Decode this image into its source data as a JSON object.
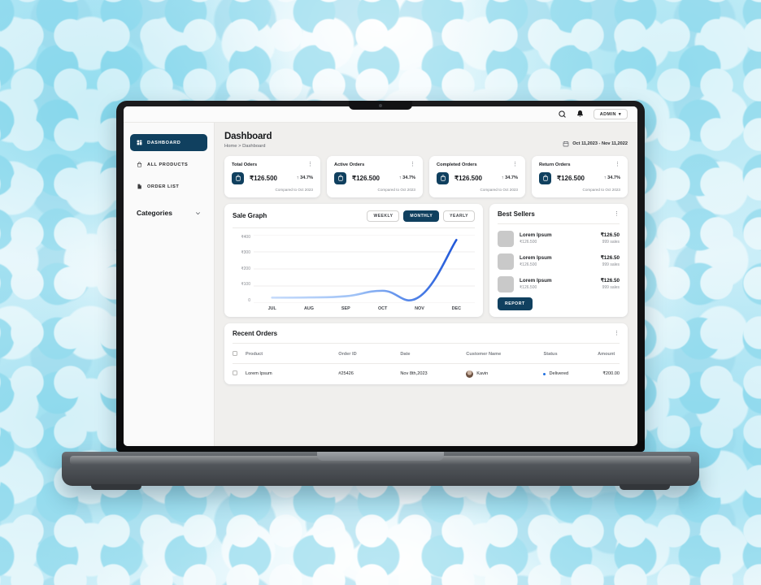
{
  "topbar": {
    "search_icon": "search-icon",
    "bell_icon": "bell-icon",
    "admin_label": "ADMIN",
    "admin_caret": "▾"
  },
  "sidebar": {
    "items": [
      {
        "label": "DASHBOARD",
        "icon": "grid-icon",
        "active": true
      },
      {
        "label": "ALL PRODUCTS",
        "icon": "bag-icon",
        "active": false
      },
      {
        "label": "ORDER LIST",
        "icon": "document-icon",
        "active": false
      }
    ],
    "categories_label": "Categories",
    "categories_icon": "chevron-down-icon"
  },
  "header": {
    "title": "Dashboard",
    "breadcrumb": "Home > Dashboard",
    "date_range": "Oct 11,2023 - Nov 11,2022",
    "calendar_icon": "calendar-icon"
  },
  "stats": [
    {
      "label": "Total Oders",
      "value": "₹126.500",
      "delta": "↑ 34.7%",
      "sub": "Compared to Oct 2023",
      "icon": "bag-icon",
      "menu": "⋮"
    },
    {
      "label": "Active Orders",
      "value": "₹126.500",
      "delta": "↑ 34.7%",
      "sub": "Compared to Oct 2023",
      "icon": "bag-icon",
      "menu": "⋮"
    },
    {
      "label": "Completed Orders",
      "value": "₹126.500",
      "delta": "↑ 34.7%",
      "sub": "Compared to Oct 2023",
      "icon": "bag-icon",
      "menu": "⋮"
    },
    {
      "label": "Return Orders",
      "value": "₹126.500",
      "delta": "↑ 34.7%",
      "sub": "Compared to Oct 2023",
      "icon": "bag-icon",
      "menu": "⋮"
    }
  ],
  "sale_graph": {
    "title": "Sale Graph",
    "segments": [
      {
        "label": "WEEKLY",
        "active": false
      },
      {
        "label": "MONTHLY",
        "active": true
      },
      {
        "label": "YEARLY",
        "active": false
      }
    ]
  },
  "chart_data": {
    "type": "line",
    "title": "Sale Graph",
    "xlabel": "",
    "ylabel": "",
    "categories": [
      "JUL",
      "AUG",
      "SEP",
      "OCT",
      "NOV",
      "DEC"
    ],
    "x_tick_labels": [
      "JUL",
      "AUG",
      "SEP",
      "OCT",
      "NOV",
      "DEC"
    ],
    "y_tick_labels": [
      "₹400",
      "₹300",
      "₹200",
      "₹100",
      "0"
    ],
    "y_ticks": [
      400,
      300,
      200,
      100,
      0
    ],
    "ylim": [
      0,
      400
    ],
    "grid": true,
    "legend": false,
    "series": [
      {
        "name": "Sales",
        "values": [
          32,
          33,
          40,
          72,
          38,
          370
        ],
        "color_start": "#c7dcfb",
        "color_end": "#2057d8"
      }
    ]
  },
  "best_sellers": {
    "title": "Best Sellers",
    "menu": "⋮",
    "items": [
      {
        "name": "Lorem Ipsum",
        "price": "₹126.500",
        "amount": "₹126.50",
        "sales": "999 sales"
      },
      {
        "name": "Lorem Ipsum",
        "price": "₹126.500",
        "amount": "₹126.50",
        "sales": "999 sales"
      },
      {
        "name": "Lorem Ipsum",
        "price": "₹126.500",
        "amount": "₹126.50",
        "sales": "999 sales"
      }
    ],
    "report_label": "REPORT"
  },
  "recent_orders": {
    "title": "Recent Orders",
    "menu": "⋮",
    "columns": [
      "Product",
      "Order ID",
      "Date",
      "Customer  Name",
      "Status",
      "Amount"
    ],
    "rows": [
      {
        "product": "Lorem Ipsum",
        "order_id": "#25426",
        "date": "Nov 8th,2023",
        "customer": "Kavin",
        "status": "Delivered",
        "amount": "₹200.00"
      }
    ]
  },
  "colors": {
    "navy": "#10405f",
    "line_blue": "#2057d8",
    "status_blue": "#1f6fe0",
    "content_bg": "#f0efed",
    "sidebar_bg": "#fafafa"
  }
}
